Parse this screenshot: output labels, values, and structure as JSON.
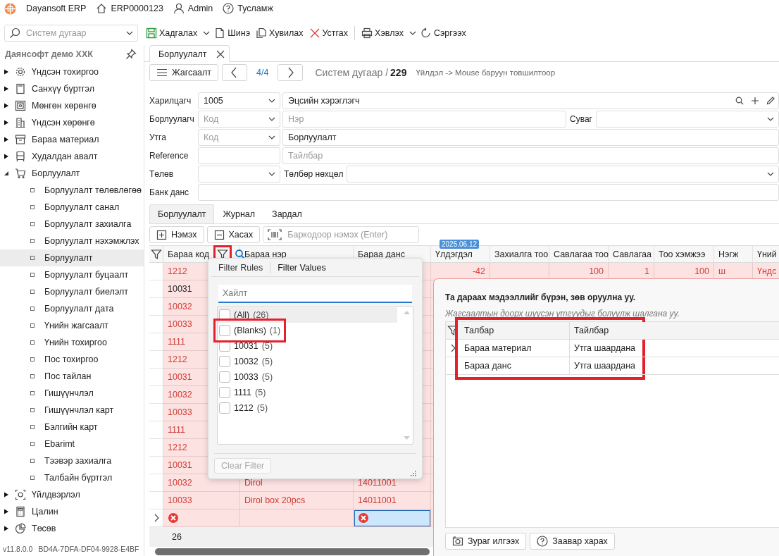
{
  "app": {
    "title": "Dayansoft ERP",
    "database": "ERP0000123",
    "user": "Admin",
    "help": "Тусламж"
  },
  "toolbar": {
    "search": {
      "placeholder": "Систем дугаар"
    },
    "buttons": [
      {
        "label": "Хадгалах",
        "kind": "save",
        "dropdown": true
      },
      {
        "label": "Шинэ",
        "kind": "new",
        "dropdown": false
      },
      {
        "label": "Хувилах",
        "kind": "copy",
        "dropdown": false
      },
      {
        "label": "Устгах",
        "kind": "delete",
        "dropdown": false
      },
      {
        "label": "Хэвлэх",
        "kind": "print",
        "dropdown": true
      },
      {
        "label": "Сэргээх",
        "kind": "refresh",
        "dropdown": false
      }
    ]
  },
  "sidebar": {
    "company": "Даянсофт демо ХХК",
    "items": [
      {
        "label": "Үндсэн тохиргоо",
        "kind": "settings",
        "expanded": false
      },
      {
        "label": "Санхүү бүртгэл",
        "kind": "book",
        "expanded": false
      },
      {
        "label": "Мөнгөн хөрөнгө",
        "kind": "safe",
        "expanded": false
      },
      {
        "label": "Үндсэн хөрөнгө",
        "kind": "building",
        "expanded": false
      },
      {
        "label": "Бараа материал",
        "kind": "box",
        "expanded": false
      },
      {
        "label": "Худалдан авалт",
        "kind": "ledger",
        "expanded": false
      },
      {
        "label": "Борлуулалт",
        "kind": "cart",
        "expanded": true,
        "children": [
          {
            "label": "Борлуулалт төлөвлөгөө",
            "selected": false
          },
          {
            "label": "Борлуулалт санал",
            "selected": false
          },
          {
            "label": "Борлуулалт захиалга",
            "selected": false
          },
          {
            "label": "Борлуулалт нэхэмжлэх",
            "selected": false
          },
          {
            "label": "Борлуулалт",
            "selected": true
          },
          {
            "label": "Борлуулалт буцаалт",
            "selected": false
          },
          {
            "label": "Борлуулалт биелэлт",
            "selected": false
          },
          {
            "label": "Борлуулалт дата",
            "selected": false
          },
          {
            "label": "Үнийн жагсаалт",
            "selected": false
          },
          {
            "label": "Үнийн тохиргоо",
            "selected": false
          },
          {
            "label": "Пос тохиргоо",
            "selected": false
          },
          {
            "label": "Пос тайлан",
            "selected": false
          },
          {
            "label": "Гишүүнчлэл",
            "selected": false
          },
          {
            "label": "Гишүүнчлэл карт",
            "selected": false
          },
          {
            "label": "Бэлгийн карт",
            "selected": false
          },
          {
            "label": "Ebarimt",
            "selected": false
          },
          {
            "label": "Тээвэр захиалга",
            "selected": false
          },
          {
            "label": "Талбайн бүртгэл",
            "selected": false
          }
        ]
      },
      {
        "label": "Үйлдвэрлэл",
        "kind": "factory",
        "expanded": false
      },
      {
        "label": "Цалин",
        "kind": "calculator",
        "expanded": false
      },
      {
        "label": "Төсөв",
        "kind": "pie",
        "expanded": false
      }
    ],
    "version": "v11.8.0.0",
    "license": "BD4A-7DFA-DF04-9928-E4BF"
  },
  "document": {
    "tab": "Борлуулалт",
    "list_button": "Жагсаалт",
    "position": "4/4",
    "number_label": "Систем дугаар /",
    "number": "229",
    "hint": "Үйлдэл -> Mouse баруун товшилтоор"
  },
  "form": {
    "rows": [
      {
        "label": "Харилцагч",
        "controls": [
          {
            "kind": "code_combo",
            "value": "1005"
          },
          {
            "kind": "lookup_field",
            "value": "Эцсийн хэрэглэгч"
          }
        ]
      },
      {
        "label": "Борлуулагч",
        "controls": [
          {
            "kind": "code_combo",
            "placeholder": "Код"
          },
          {
            "kind": "field",
            "placeholder": "Нэр"
          },
          {
            "kind": "label",
            "text": "Суваг"
          },
          {
            "kind": "combo"
          }
        ]
      },
      {
        "label": "Утга",
        "controls": [
          {
            "kind": "code_combo",
            "placeholder": "Код"
          },
          {
            "kind": "field",
            "value": "Борлуулалт"
          }
        ]
      },
      {
        "label": "Reference",
        "controls": [
          {
            "kind": "code_field"
          },
          {
            "kind": "field",
            "placeholder": "Тайлбар"
          }
        ]
      },
      {
        "label": "Төлөв",
        "controls": [
          {
            "kind": "code_combo"
          },
          {
            "kind": "label",
            "text": "Төлбөр нөхцөл"
          },
          {
            "kind": "combo"
          }
        ]
      },
      {
        "label": "Банк данс",
        "controls": [
          {
            "kind": "field"
          }
        ]
      }
    ]
  },
  "detail_tabs": [
    {
      "label": "Борлуулалт",
      "selected": true
    },
    {
      "label": "Журнал",
      "selected": false
    },
    {
      "label": "Зардал",
      "selected": false
    }
  ],
  "grid_toolbar": {
    "add": "Нэмэх",
    "remove": "Хасах",
    "barcode_placeholder": "Баркодоор нэмэх (Enter)"
  },
  "grid": {
    "columns": [
      {
        "label": "Бараа код",
        "filter_button": true,
        "search_button": true,
        "highlighted": true
      },
      {
        "label": "Бараа нэр"
      },
      {
        "label": "Бараа данс"
      },
      {
        "label": "Үлдэгдэл",
        "badge": "2025.06.12"
      },
      {
        "label": "Захиалга тоо"
      },
      {
        "label": "Савлагаа тоо"
      },
      {
        "label": "Савлагаа"
      },
      {
        "label": "Тоо хэмжээ"
      },
      {
        "label": "Нэгж"
      },
      {
        "label": "Үний"
      }
    ],
    "rows": [
      {
        "kind": "data",
        "error": true,
        "code": "1212",
        "balance": "-42",
        "packs": "100",
        "pack": "1",
        "qty": "100",
        "unit": "ш",
        "price": "Үндс"
      },
      {
        "kind": "data",
        "error": false,
        "code": "10031"
      },
      {
        "kind": "data",
        "error": true,
        "code": "10032"
      },
      {
        "kind": "data",
        "error": true,
        "code": "10033"
      },
      {
        "kind": "data",
        "error": true,
        "code": "1111"
      },
      {
        "kind": "data",
        "error": true,
        "code": "1212"
      },
      {
        "kind": "data",
        "error": true,
        "code": "10031"
      },
      {
        "kind": "data",
        "error": true,
        "code": "10032"
      },
      {
        "kind": "data",
        "error": true,
        "code": "10033"
      },
      {
        "kind": "data",
        "error": true,
        "code": "1111"
      },
      {
        "kind": "data",
        "error": true,
        "code": "1212"
      },
      {
        "kind": "data",
        "error": true,
        "code": "10031"
      },
      {
        "kind": "data",
        "error": true,
        "code": "10032",
        "name": "Dirol",
        "account": "14011001"
      },
      {
        "kind": "data",
        "error": true,
        "code": "10033",
        "name": "Dirol box 20pcs",
        "account": "14011001"
      },
      {
        "kind": "new",
        "current": true,
        "code_error": true,
        "account_error": true,
        "account_focused": true
      }
    ],
    "footer_count": "26"
  },
  "filter_popup": {
    "tabs": [
      {
        "label": "Filter Rules",
        "selected": false
      },
      {
        "label": "Filter Values",
        "selected": true
      }
    ],
    "search_placeholder": "Хайлт",
    "items": [
      {
        "label": "(All)",
        "count": "(26)",
        "checked": false,
        "hovered": true,
        "highlighted": false
      },
      {
        "label": "(Blanks)",
        "count": "(1)",
        "checked": false,
        "hovered": false,
        "highlighted": true
      },
      {
        "label": "10031",
        "count": "(5)",
        "checked": false,
        "hovered": false,
        "highlighted": false
      },
      {
        "label": "10032",
        "count": "(5)",
        "checked": false,
        "hovered": false,
        "highlighted": false
      },
      {
        "label": "10033",
        "count": "(5)",
        "checked": false,
        "hovered": false,
        "highlighted": false
      },
      {
        "label": "1111",
        "count": "(5)",
        "checked": false,
        "hovered": false,
        "highlighted": false
      },
      {
        "label": "1212",
        "count": "(5)",
        "checked": false,
        "hovered": false,
        "highlighted": false
      }
    ],
    "clear_button": {
      "label": "Clear Filter",
      "disabled": true
    }
  },
  "dialog": {
    "message": "Та дараах мэдээллийг бүрэн, зөв оруулна уу.",
    "hint": "Жагсаалтын доорх шүүсэн утгуудыг болуулж шалгана уу.",
    "grid": {
      "highlighted": true,
      "columns": [
        "Талбар",
        "Тайлбар"
      ],
      "rows": [
        {
          "field": "Бараа материал",
          "description": "Утга шаардана",
          "current": true
        },
        {
          "field": "Бараа данс",
          "description": "Утга шаардана",
          "current": false
        }
      ]
    },
    "buttons": [
      {
        "label": "Зураг илгээх",
        "kind": "camera"
      },
      {
        "label": "Заавар харах",
        "kind": "help"
      }
    ]
  }
}
